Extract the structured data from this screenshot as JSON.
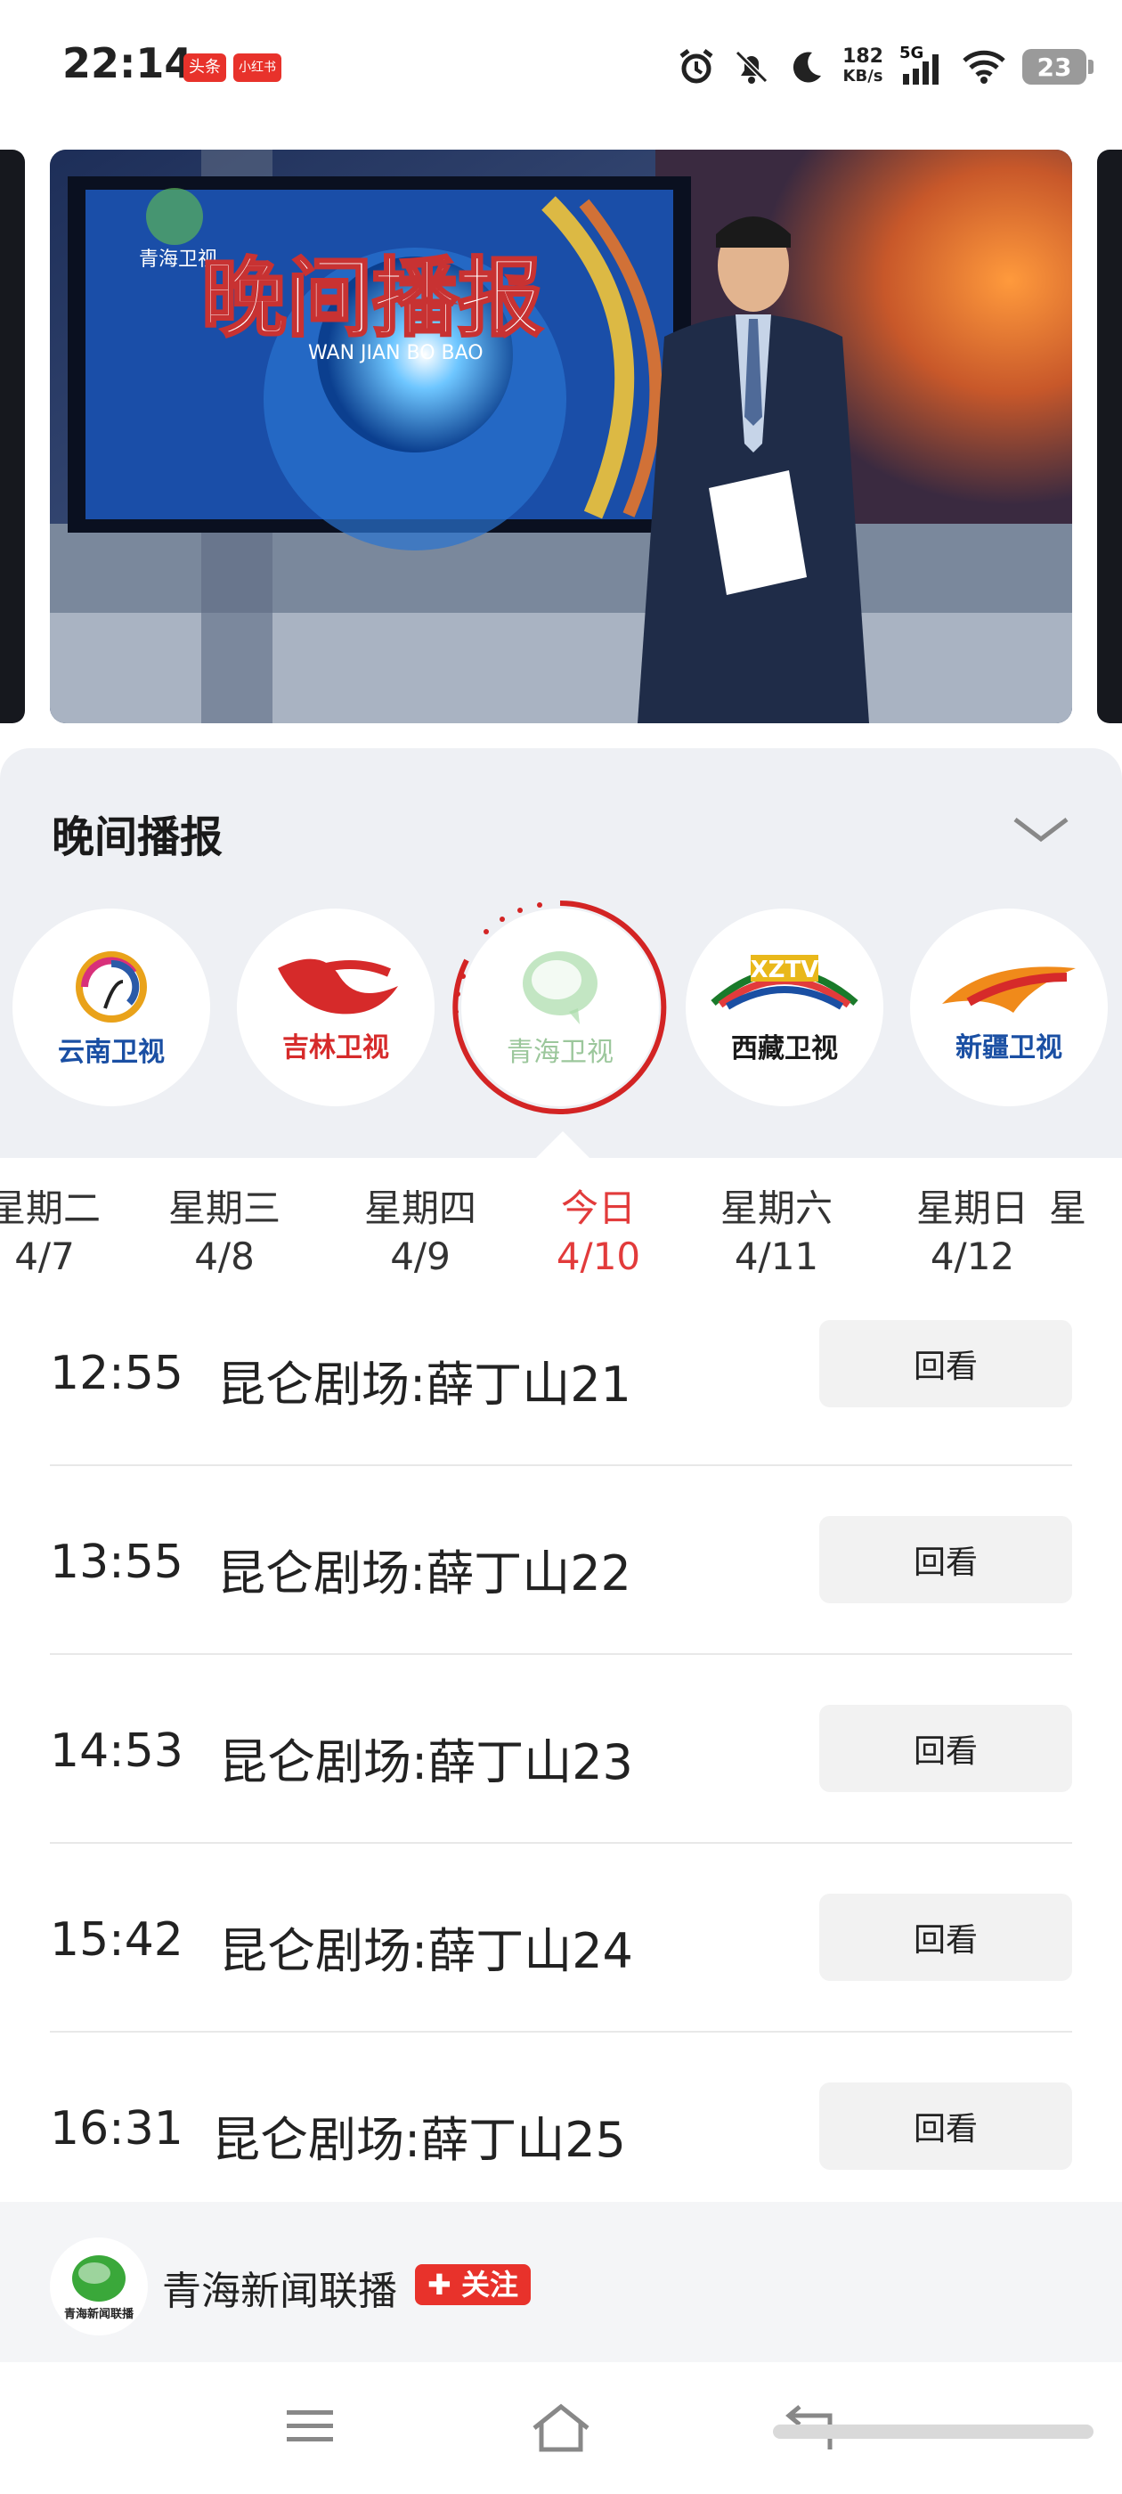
{
  "status_bar": {
    "time": "22:14",
    "badge_1": "头条",
    "badge_2": "小红书",
    "network_speed_value": "182",
    "network_speed_unit": "KB/s",
    "signal_label": "5G",
    "battery": "23"
  },
  "panel": {
    "title": "晚间播报",
    "channels": [
      {
        "name": "云南卫视",
        "color": "#1a4fa3"
      },
      {
        "name": "吉林卫视",
        "color": "#d62a2a"
      },
      {
        "name": "青海卫视",
        "color": "#8ec38e",
        "selected": true
      },
      {
        "name": "西藏卫视",
        "color": "#1a1a1a",
        "logo_text": "XZTV"
      },
      {
        "name": "新疆卫视",
        "color": "#1a4fa3"
      }
    ]
  },
  "days": [
    {
      "weekday": "星期二",
      "date": "4/7"
    },
    {
      "weekday": "星期三",
      "date": "4/8"
    },
    {
      "weekday": "星期四",
      "date": "4/9"
    },
    {
      "weekday": "今日",
      "date": "4/10",
      "active": true
    },
    {
      "weekday": "星期六",
      "date": "4/11"
    },
    {
      "weekday": "星期日",
      "date": "4/12"
    },
    {
      "weekday": "星",
      "date": ""
    }
  ],
  "programs": [
    {
      "time": "12:55",
      "title": "昆仑剧场:薛丁山21",
      "action": "回看"
    },
    {
      "time": "13:55",
      "title": "昆仑剧场:薛丁山22",
      "action": "回看"
    },
    {
      "time": "14:53",
      "title": "昆仑剧场:薛丁山23",
      "action": "回看"
    },
    {
      "time": "15:42",
      "title": "昆仑剧场:薛丁山24",
      "action": "回看"
    },
    {
      "time": "16:31",
      "title": "昆仑剧场:薛丁山25",
      "action": "回看"
    }
  ],
  "account": {
    "name": "青海新闻联播",
    "logo_caption": "青海新闻联播",
    "follow_label": "✚ 关注"
  },
  "video": {
    "logo_text": "青海卫视",
    "program_title": "晚间播报",
    "program_pinyin": "WAN JIAN BO BAO"
  },
  "colors": {
    "accent": "#e23b3b",
    "panel_bg": "#eef0f4"
  }
}
